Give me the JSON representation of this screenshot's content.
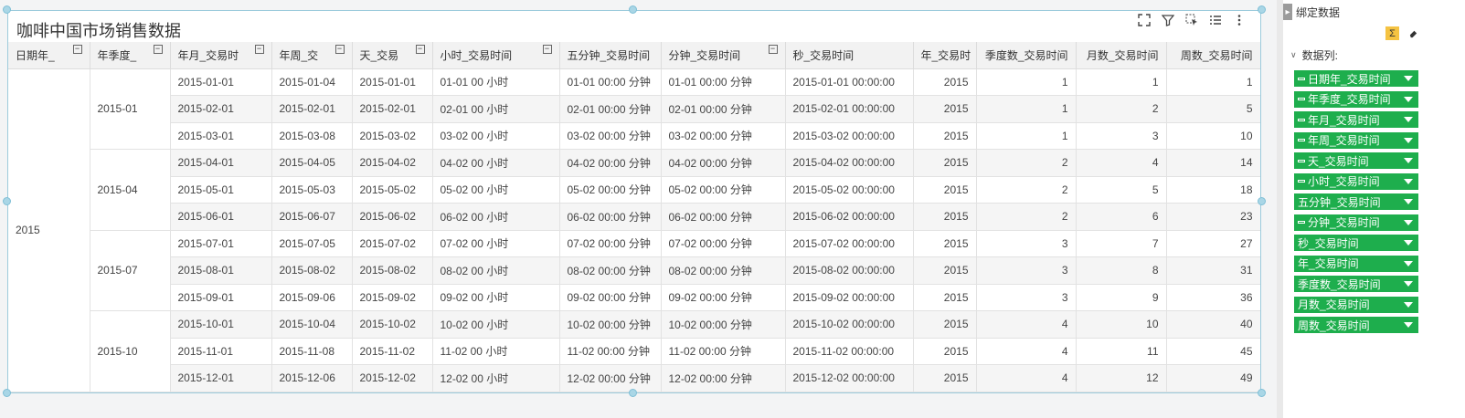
{
  "card": {
    "title": "咖啡中国市场销售数据"
  },
  "toolbar": {
    "icons": [
      "fullscreen-icon",
      "filter-icon",
      "select-icon",
      "list-icon",
      "more-icon"
    ]
  },
  "table": {
    "headers": [
      {
        "label": "日期年_",
        "collapsible": true,
        "align": "left"
      },
      {
        "label": "年季度_",
        "collapsible": true,
        "align": "left"
      },
      {
        "label": "年月_交易时",
        "collapsible": true,
        "align": "left"
      },
      {
        "label": "年周_交",
        "collapsible": true,
        "align": "left"
      },
      {
        "label": "天_交易",
        "collapsible": true,
        "align": "left"
      },
      {
        "label": "小时_交易时间",
        "collapsible": true,
        "align": "left"
      },
      {
        "label": "五分钟_交易时间",
        "collapsible": false,
        "align": "left"
      },
      {
        "label": "分钟_交易时间",
        "collapsible": true,
        "align": "left"
      },
      {
        "label": "秒_交易时间",
        "collapsible": false,
        "align": "left"
      },
      {
        "label": "年_交易时",
        "collapsible": false,
        "align": "right"
      },
      {
        "label": "季度数_交易时间",
        "collapsible": false,
        "align": "right"
      },
      {
        "label": "月数_交易时间",
        "collapsible": false,
        "align": "right"
      },
      {
        "label": "周数_交易时间",
        "collapsible": false,
        "align": "right"
      }
    ],
    "year": "2015",
    "quarters": [
      "2015-01",
      "2015-04",
      "2015-07",
      "2015-10"
    ],
    "rows": [
      [
        "2015-01-01",
        "2015-01-04",
        "2015-01-01",
        "01-01 00 小时",
        "01-01 00:00 分钟",
        "01-01 00:00 分钟",
        "2015-01-01 00:00:00",
        "2015",
        "1",
        "1",
        "1"
      ],
      [
        "2015-02-01",
        "2015-02-01",
        "2015-02-01",
        "02-01 00 小时",
        "02-01 00:00 分钟",
        "02-01 00:00 分钟",
        "2015-02-01 00:00:00",
        "2015",
        "1",
        "2",
        "5"
      ],
      [
        "2015-03-01",
        "2015-03-08",
        "2015-03-02",
        "03-02 00 小时",
        "03-02 00:00 分钟",
        "03-02 00:00 分钟",
        "2015-03-02 00:00:00",
        "2015",
        "1",
        "3",
        "10"
      ],
      [
        "2015-04-01",
        "2015-04-05",
        "2015-04-02",
        "04-02 00 小时",
        "04-02 00:00 分钟",
        "04-02 00:00 分钟",
        "2015-04-02 00:00:00",
        "2015",
        "2",
        "4",
        "14"
      ],
      [
        "2015-05-01",
        "2015-05-03",
        "2015-05-02",
        "05-02 00 小时",
        "05-02 00:00 分钟",
        "05-02 00:00 分钟",
        "2015-05-02 00:00:00",
        "2015",
        "2",
        "5",
        "18"
      ],
      [
        "2015-06-01",
        "2015-06-07",
        "2015-06-02",
        "06-02 00 小时",
        "06-02 00:00 分钟",
        "06-02 00:00 分钟",
        "2015-06-02 00:00:00",
        "2015",
        "2",
        "6",
        "23"
      ],
      [
        "2015-07-01",
        "2015-07-05",
        "2015-07-02",
        "07-02 00 小时",
        "07-02 00:00 分钟",
        "07-02 00:00 分钟",
        "2015-07-02 00:00:00",
        "2015",
        "3",
        "7",
        "27"
      ],
      [
        "2015-08-01",
        "2015-08-02",
        "2015-08-02",
        "08-02 00 小时",
        "08-02 00:00 分钟",
        "08-02 00:00 分钟",
        "2015-08-02 00:00:00",
        "2015",
        "3",
        "8",
        "31"
      ],
      [
        "2015-09-01",
        "2015-09-06",
        "2015-09-02",
        "09-02 00 小时",
        "09-02 00:00 分钟",
        "09-02 00:00 分钟",
        "2015-09-02 00:00:00",
        "2015",
        "3",
        "9",
        "36"
      ],
      [
        "2015-10-01",
        "2015-10-04",
        "2015-10-02",
        "10-02 00 小时",
        "10-02 00:00 分钟",
        "10-02 00:00 分钟",
        "2015-10-02 00:00:00",
        "2015",
        "4",
        "10",
        "40"
      ],
      [
        "2015-11-01",
        "2015-11-08",
        "2015-11-02",
        "11-02 00 小时",
        "11-02 00:00 分钟",
        "11-02 00:00 分钟",
        "2015-11-02 00:00:00",
        "2015",
        "4",
        "11",
        "45"
      ],
      [
        "2015-12-01",
        "2015-12-06",
        "2015-12-02",
        "12-02 00 小时",
        "12-02 00:00 分钟",
        "12-02 00:00 分钟",
        "2015-12-02 00:00:00",
        "2015",
        "4",
        "12",
        "49"
      ]
    ]
  },
  "panel": {
    "title": "绑定数据",
    "sum_icon": "Σ",
    "columns_label": "数据列:",
    "fields": [
      {
        "label": "日期年_交易时间",
        "dimension": true
      },
      {
        "label": "年季度_交易时间",
        "dimension": true
      },
      {
        "label": "年月_交易时间",
        "dimension": true
      },
      {
        "label": "年周_交易时间",
        "dimension": true
      },
      {
        "label": "天_交易时间",
        "dimension": true
      },
      {
        "label": "小时_交易时间",
        "dimension": true
      },
      {
        "label": "五分钟_交易时间",
        "dimension": false
      },
      {
        "label": "分钟_交易时间",
        "dimension": true
      },
      {
        "label": "秒_交易时间",
        "dimension": false
      },
      {
        "label": "年_交易时间",
        "dimension": false
      },
      {
        "label": "季度数_交易时间",
        "dimension": false
      },
      {
        "label": "月数_交易时间",
        "dimension": false
      },
      {
        "label": "周数_交易时间",
        "dimension": false
      }
    ]
  },
  "colors": {
    "field_green": "#1eae4d",
    "selection_blue": "#9ccbdc",
    "sum_yellow": "#f5c342"
  }
}
